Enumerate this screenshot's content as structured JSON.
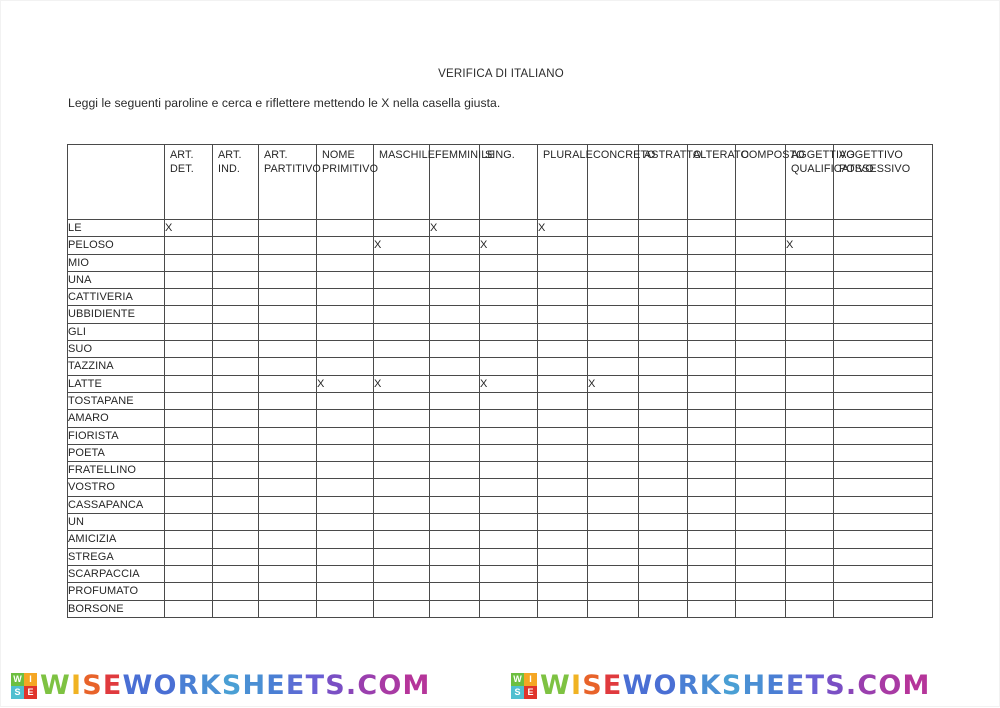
{
  "document": {
    "title": "VERIFICA DI ITALIANO",
    "instructions": "Leggi le seguenti paroline e cerca e riflettere mettendo le X nella casella giusta."
  },
  "table": {
    "corner_header": "",
    "columns": [
      "ART. DET.",
      "ART. IND.",
      "ART. PARTITIVO",
      "NOME PRIMITIVO",
      "MASCHILE",
      "FEMMINILE",
      "SING.",
      "PLURALE",
      "CONCRETO",
      "ASTRATTO",
      "ALTERATO",
      "COMPOSTO",
      "AGGETTIVO QUALIFICATIVO",
      "AGGETTIVO POSSESSIVO"
    ],
    "mark": "X",
    "rows": [
      {
        "word": "LE",
        "marks": [
          1,
          0,
          0,
          0,
          0,
          1,
          0,
          1,
          0,
          0,
          0,
          0,
          0,
          0
        ]
      },
      {
        "word": "PELOSO",
        "marks": [
          0,
          0,
          0,
          0,
          1,
          0,
          1,
          0,
          0,
          0,
          0,
          0,
          1,
          0
        ]
      },
      {
        "word": "MIO",
        "marks": [
          0,
          0,
          0,
          0,
          0,
          0,
          0,
          0,
          0,
          0,
          0,
          0,
          0,
          0
        ]
      },
      {
        "word": "UNA",
        "marks": [
          0,
          0,
          0,
          0,
          0,
          0,
          0,
          0,
          0,
          0,
          0,
          0,
          0,
          0
        ]
      },
      {
        "word": "CATTIVERIA",
        "marks": [
          0,
          0,
          0,
          0,
          0,
          0,
          0,
          0,
          0,
          0,
          0,
          0,
          0,
          0
        ]
      },
      {
        "word": "UBBIDIENTE",
        "marks": [
          0,
          0,
          0,
          0,
          0,
          0,
          0,
          0,
          0,
          0,
          0,
          0,
          0,
          0
        ]
      },
      {
        "word": "GLI",
        "marks": [
          0,
          0,
          0,
          0,
          0,
          0,
          0,
          0,
          0,
          0,
          0,
          0,
          0,
          0
        ]
      },
      {
        "word": "SUO",
        "marks": [
          0,
          0,
          0,
          0,
          0,
          0,
          0,
          0,
          0,
          0,
          0,
          0,
          0,
          0
        ]
      },
      {
        "word": "TAZZINA",
        "marks": [
          0,
          0,
          0,
          0,
          0,
          0,
          0,
          0,
          0,
          0,
          0,
          0,
          0,
          0
        ]
      },
      {
        "word": "LATTE",
        "marks": [
          0,
          0,
          0,
          1,
          1,
          0,
          1,
          0,
          1,
          0,
          0,
          0,
          0,
          0
        ]
      },
      {
        "word": "TOSTAPANE",
        "marks": [
          0,
          0,
          0,
          0,
          0,
          0,
          0,
          0,
          0,
          0,
          0,
          0,
          0,
          0
        ]
      },
      {
        "word": "AMARO",
        "marks": [
          0,
          0,
          0,
          0,
          0,
          0,
          0,
          0,
          0,
          0,
          0,
          0,
          0,
          0
        ]
      },
      {
        "word": "FIORISTA",
        "marks": [
          0,
          0,
          0,
          0,
          0,
          0,
          0,
          0,
          0,
          0,
          0,
          0,
          0,
          0
        ]
      },
      {
        "word": "POETA",
        "marks": [
          0,
          0,
          0,
          0,
          0,
          0,
          0,
          0,
          0,
          0,
          0,
          0,
          0,
          0
        ]
      },
      {
        "word": "FRATELLINO",
        "marks": [
          0,
          0,
          0,
          0,
          0,
          0,
          0,
          0,
          0,
          0,
          0,
          0,
          0,
          0
        ]
      },
      {
        "word": "VOSTRO",
        "marks": [
          0,
          0,
          0,
          0,
          0,
          0,
          0,
          0,
          0,
          0,
          0,
          0,
          0,
          0
        ]
      },
      {
        "word": "CASSAPANCA",
        "marks": [
          0,
          0,
          0,
          0,
          0,
          0,
          0,
          0,
          0,
          0,
          0,
          0,
          0,
          0
        ]
      },
      {
        "word": "UN",
        "marks": [
          0,
          0,
          0,
          0,
          0,
          0,
          0,
          0,
          0,
          0,
          0,
          0,
          0,
          0
        ]
      },
      {
        "word": "AMICIZIA",
        "marks": [
          0,
          0,
          0,
          0,
          0,
          0,
          0,
          0,
          0,
          0,
          0,
          0,
          0,
          0
        ]
      },
      {
        "word": "STREGA",
        "marks": [
          0,
          0,
          0,
          0,
          0,
          0,
          0,
          0,
          0,
          0,
          0,
          0,
          0,
          0
        ]
      },
      {
        "word": "SCARPACCIA",
        "marks": [
          0,
          0,
          0,
          0,
          0,
          0,
          0,
          0,
          0,
          0,
          0,
          0,
          0,
          0
        ]
      },
      {
        "word": "PROFUMATO",
        "marks": [
          0,
          0,
          0,
          0,
          0,
          0,
          0,
          0,
          0,
          0,
          0,
          0,
          0,
          0
        ]
      },
      {
        "word": "BORSONE",
        "marks": [
          0,
          0,
          0,
          0,
          0,
          0,
          0,
          0,
          0,
          0,
          0,
          0,
          0,
          0
        ]
      }
    ]
  },
  "watermark": {
    "logo_letters": [
      "W",
      "I",
      "S",
      "E"
    ],
    "text": "WISEWORKSHEETS.COM",
    "letter_colors": [
      "#7ec242",
      "#f0b323",
      "#e8632a",
      "#e03a3e",
      "#4a6fd4",
      "#4a6fd4",
      "#4a7fd4",
      "#4a8fd4",
      "#4a9fd4",
      "#4a8fd4",
      "#4a7fd4",
      "#5a6fd4",
      "#6a5fd4",
      "#7a4fc4",
      "#8a45b8",
      "#9a3fae",
      "#a83aa4",
      "#b5359a"
    ],
    "count": 2
  }
}
